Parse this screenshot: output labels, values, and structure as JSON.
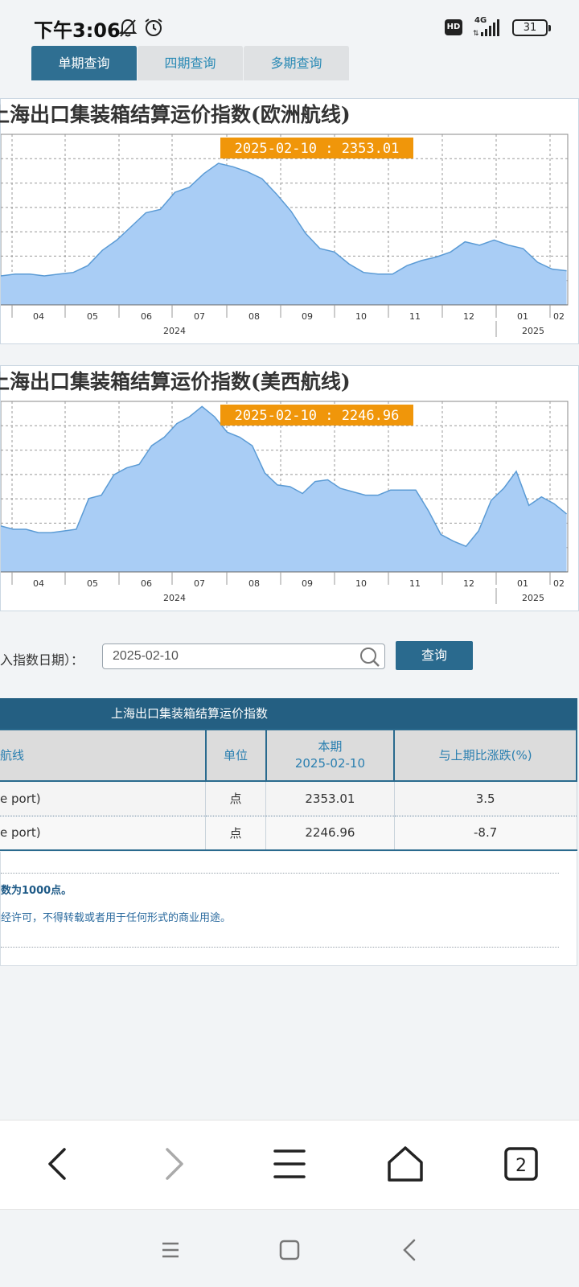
{
  "status_bar": {
    "time": "下午3:06",
    "hd": "HD",
    "network": "4G",
    "battery": "31"
  },
  "tabs": [
    {
      "label": "单期查询",
      "active": true
    },
    {
      "label": "四期查询",
      "active": false
    },
    {
      "label": "多期查询",
      "active": false
    }
  ],
  "charts": [
    {
      "title": "上海出口集装箱结算运价指数(欧洲航线)",
      "tooltip": "2025-02-10 : 2353.01"
    },
    {
      "title": "上海出口集装箱结算运价指数(美西航线)",
      "tooltip": "2025-02-10 : 2246.96"
    }
  ],
  "chart_data": [
    {
      "type": "area",
      "title": "上海出口集装箱结算运价指数(欧洲航线)",
      "x_tick_labels": [
        "04",
        "05",
        "06",
        "07",
        "08",
        "09",
        "10",
        "11",
        "12",
        "01",
        "02"
      ],
      "year_labels": [
        "2024",
        "2025"
      ],
      "tooltip": "2025-02-10 : 2353.01",
      "grid": true,
      "color": "#a9cdf5",
      "line_color": "#5b9bd5",
      "y_relative": [
        0.17,
        0.18,
        0.18,
        0.17,
        0.18,
        0.19,
        0.23,
        0.32,
        0.38,
        0.46,
        0.54,
        0.56,
        0.66,
        0.69,
        0.77,
        0.83,
        0.81,
        0.78,
        0.74,
        0.65,
        0.55,
        0.42,
        0.33,
        0.31,
        0.24,
        0.19,
        0.18,
        0.18,
        0.23,
        0.26,
        0.28,
        0.31,
        0.37,
        0.35,
        0.38,
        0.35,
        0.33,
        0.25,
        0.21,
        0.2
      ]
    },
    {
      "type": "area",
      "title": "上海出口集装箱结算运价指数(美西航线)",
      "x_tick_labels": [
        "04",
        "05",
        "06",
        "07",
        "08",
        "09",
        "10",
        "11",
        "12",
        "01",
        "02"
      ],
      "year_labels": [
        "2024",
        "2025"
      ],
      "tooltip": "2025-02-10 : 2246.96",
      "grid": true,
      "color": "#a9cdf5",
      "line_color": "#5b9bd5",
      "y_relative": [
        0.27,
        0.25,
        0.25,
        0.23,
        0.23,
        0.24,
        0.25,
        0.43,
        0.45,
        0.57,
        0.61,
        0.63,
        0.74,
        0.79,
        0.87,
        0.91,
        0.97,
        0.91,
        0.82,
        0.79,
        0.74,
        0.58,
        0.51,
        0.5,
        0.46,
        0.53,
        0.54,
        0.49,
        0.47,
        0.45,
        0.45,
        0.48,
        0.48,
        0.48,
        0.36,
        0.22,
        0.18,
        0.15,
        0.24,
        0.42,
        0.49,
        0.59,
        0.39,
        0.44,
        0.4,
        0.34
      ]
    }
  ],
  "query": {
    "label": "入指数日期）：",
    "date_value": "2025-02-10",
    "button_label": "查询"
  },
  "table": {
    "title": "上海出口集装箱结算运价指数",
    "headers": {
      "route": "航线",
      "unit": "单位",
      "current_line1": "本期",
      "current_line2": "2025-02-10",
      "change": "与上期比涨跌(%)"
    },
    "rows": [
      {
        "route": "e port)",
        "unit": "点",
        "value": "2353.01",
        "change": "3.5"
      },
      {
        "route": "e port)",
        "unit": "点",
        "value": "2246.96",
        "change": "-8.7"
      }
    ]
  },
  "notes": {
    "line1": "数为1000点。",
    "line2": "经许可，不得转载或者用于任何形式的商业用途。"
  },
  "browser_nav": {
    "tab_count": "2"
  }
}
